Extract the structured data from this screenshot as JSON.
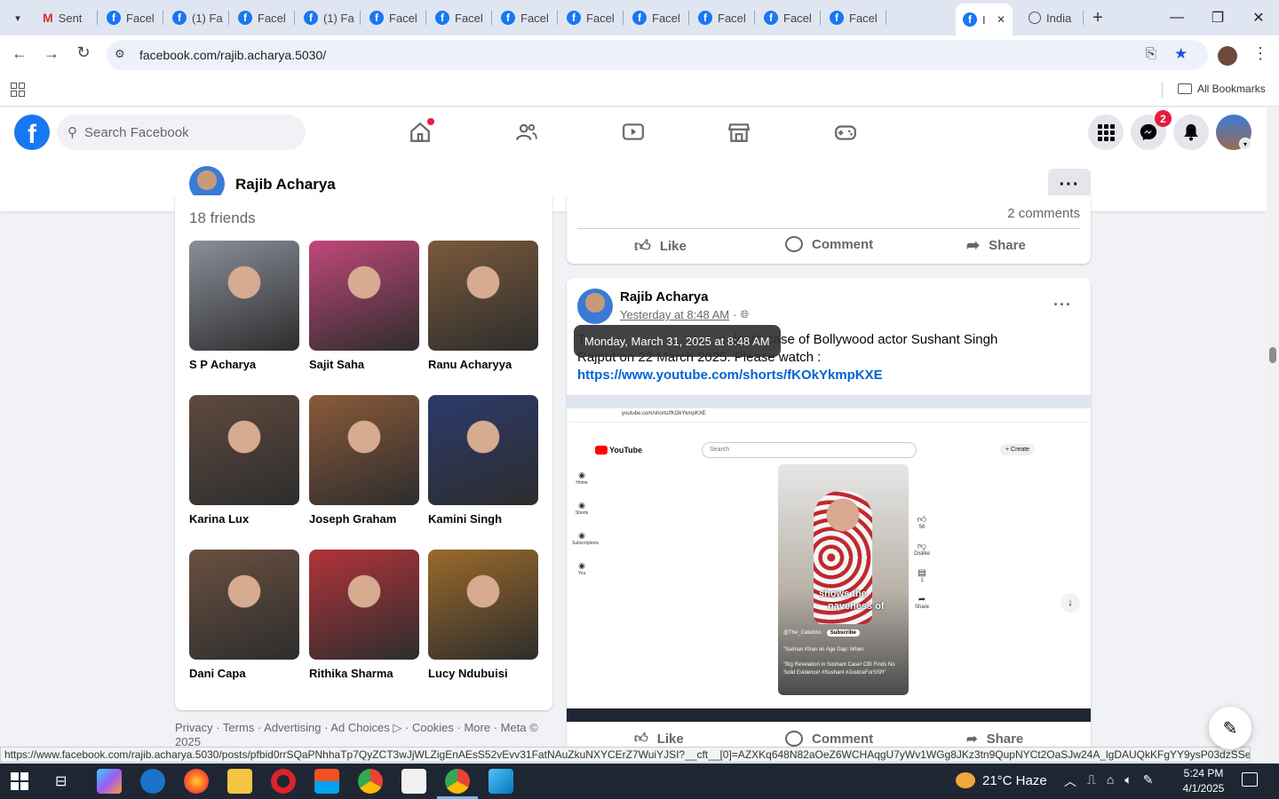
{
  "browser": {
    "tabs": [
      {
        "label": "Sent",
        "icon": "gmail-icon"
      },
      {
        "label": "Facel",
        "icon": "facebook-icon"
      },
      {
        "label": "(1) Fa",
        "icon": "facebook-icon"
      },
      {
        "label": "Facel",
        "icon": "facebook-icon"
      },
      {
        "label": "(1) Fa",
        "icon": "facebook-icon"
      },
      {
        "label": "Facel",
        "icon": "facebook-icon"
      },
      {
        "label": "Facel",
        "icon": "facebook-icon"
      },
      {
        "label": "Facel",
        "icon": "facebook-icon"
      },
      {
        "label": "Facel",
        "icon": "facebook-icon"
      },
      {
        "label": "Facel",
        "icon": "facebook-icon"
      },
      {
        "label": "Facel",
        "icon": "facebook-icon"
      },
      {
        "label": "Facel",
        "icon": "facebook-icon"
      },
      {
        "label": "Facel",
        "icon": "facebook-icon"
      },
      {
        "label": "I",
        "icon": "facebook-icon",
        "active": true
      },
      {
        "label": "India",
        "icon": "globe-icon"
      }
    ],
    "url": "facebook.com/rajib.acharya.5030/",
    "all_bookmarks": "All Bookmarks",
    "status_url": "https://www.facebook.com/rajib.acharya.5030/posts/pfbid0rrSQaPNhhaTp7QyZCT3wJjWLZigEnAEsS52vEvv31FatNAuZkuNXYCErZ7WuiYJSI?__cft__[0]=AZXKq648N82aOeZ6WCHAqgU7yWv1WGg8JKz3tn9QupNYCt2OaSJw24A_lgDAUQkKFgYY9ysP03dzSSezY4lx58u..."
  },
  "facebook": {
    "search_placeholder": "Search Facebook",
    "messenger_badge": "2",
    "accent": "#1877f2",
    "profile_name": "Rajib Acharya",
    "friends_count": "18 friends",
    "friends": [
      {
        "name": "S P Acharya",
        "color": "#8a8f99"
      },
      {
        "name": "Sajit Saha",
        "color": "#c2477a"
      },
      {
        "name": "Ranu Acharyya",
        "color": "#7a5a3a"
      },
      {
        "name": "Karina Lux",
        "color": "#5e4a3e"
      },
      {
        "name": "Joseph Graham",
        "color": "#8a5a3a"
      },
      {
        "name": "Kamini Singh",
        "color": "#2b3a6b"
      },
      {
        "name": "Dani Capa",
        "color": "#6a5040"
      },
      {
        "name": "Rithika Sharma",
        "color": "#b2333a"
      },
      {
        "name": "Lucy Ndubuisi",
        "color": "#9a6a2a"
      }
    ],
    "footer_links": "Privacy · Terms · Advertising · Ad Choices ▷ · Cookies · More · Meta © 2025",
    "prev_post_comments": "2 comments",
    "actions": {
      "like": "Like",
      "comment": "Comment",
      "share": "Share"
    },
    "post": {
      "author": "Rajib Acharya",
      "time": "Yesterday at 8:48 AM",
      "tooltip": "Monday, March 31, 2025 at 8:48 AM",
      "text_line1": "T                                    e death case of Bollywood actor Sushant Singh",
      "text_line2": "Rajput on 22 March 2025. Please watch :",
      "link": "https://www.youtube.com/shorts/fKOkYkmpKXE"
    },
    "embedded_screenshot": {
      "url": "youtube.com/shorts/fKOkYkmpKXE",
      "search": "Search",
      "create": "Create",
      "side": [
        "Home",
        "Shorts",
        "Subscriptions",
        "You"
      ],
      "video_overlay1": "shows the",
      "video_overlay2": "naveness of",
      "channel": "@The_Celebiss",
      "subscribe": "Subscribe",
      "caption1": "\"Salman Khan on Age Gap: When",
      "caption2": "\"Big Revelation in Sushant Case! CBI Finds No Solid Evidence! #Sushant #JusticeForSSR\"",
      "likes": "56",
      "dislike": "Dislike",
      "comments": "1",
      "share": "Share"
    }
  },
  "taskbar": {
    "weather": "21°C  Haze",
    "time": "5:24 PM",
    "date": "4/1/2025"
  }
}
